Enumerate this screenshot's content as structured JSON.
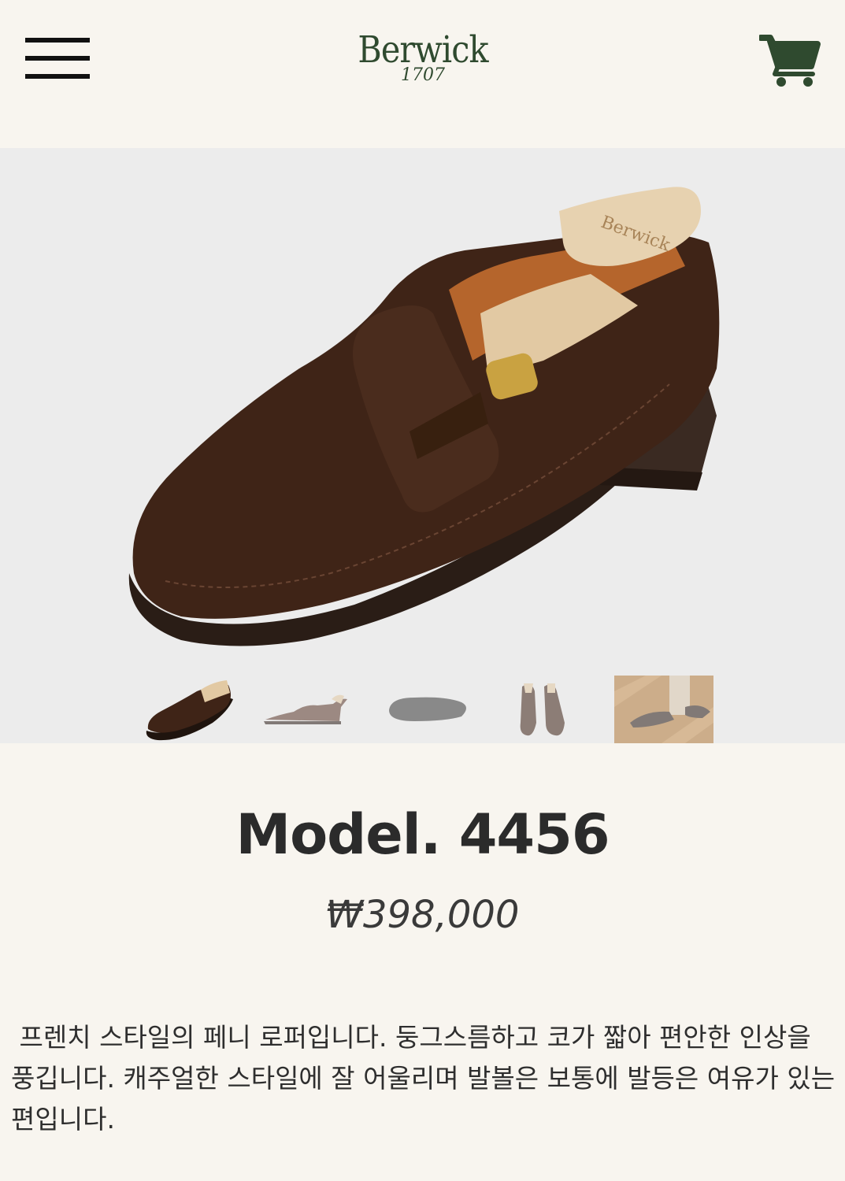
{
  "header": {
    "menu_icon": "hamburger-menu-icon",
    "logo": {
      "name": "Berwick",
      "year": "1707"
    },
    "cart_icon": "shopping-cart-icon",
    "brand_color": "#2f4a2f"
  },
  "gallery": {
    "main_image": "brown suede penny loafer with wooden shoe tree",
    "thumbnails": [
      {
        "label": "loafer-angle-view",
        "selected": true
      },
      {
        "label": "loafer-side-view",
        "selected": false
      },
      {
        "label": "loafer-sole-view",
        "selected": false
      },
      {
        "label": "loafer-pair-top-view",
        "selected": false
      },
      {
        "label": "loafer-worn-lifestyle",
        "selected": false
      }
    ],
    "background": "#ececec"
  },
  "product": {
    "title": "Model. 4456",
    "price": "₩398,000",
    "description": " 프렌치 스타일의 페니 로퍼입니다. 둥그스름하고 코가 짧아 편안한 인상을 풍깁니다. 캐주얼한 스타일에 잘 어울리며 발볼은 보통에 발등은 여유가 있는 편입니다."
  },
  "colors": {
    "page_background": "#f8f5ef",
    "suede_brown": "#3f2417"
  }
}
